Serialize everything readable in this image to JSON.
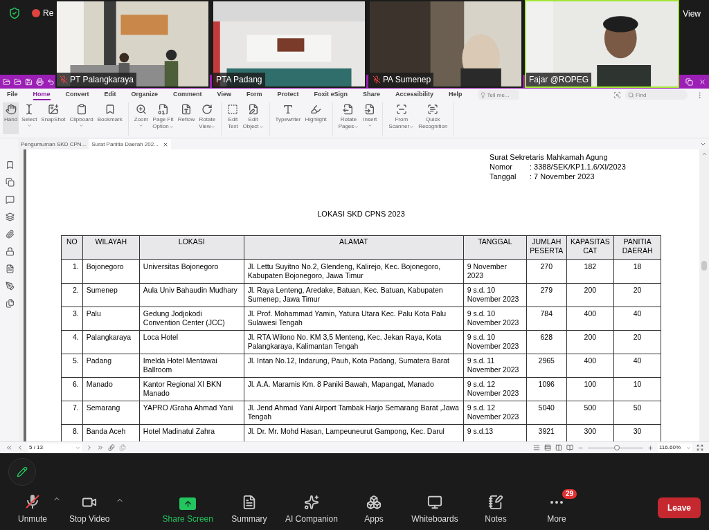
{
  "meeting": {
    "recording_label": "Re",
    "view_label": "View",
    "participants": [
      {
        "name": "PT Palangkaraya",
        "muted": true,
        "active": false
      },
      {
        "name": "PTA Padang",
        "muted": false,
        "active": false
      },
      {
        "name": "PA Sumenep",
        "muted": true,
        "active": false
      },
      {
        "name": "Fajar @ROPEG",
        "muted": false,
        "active": true
      }
    ]
  },
  "menu": [
    {
      "label": "File",
      "selected": false
    },
    {
      "label": "Home",
      "selected": true
    },
    {
      "label": "Convert",
      "selected": false
    },
    {
      "label": "Edit",
      "selected": false
    },
    {
      "label": "Organize",
      "selected": false
    },
    {
      "label": "Comment",
      "selected": false
    },
    {
      "label": "View",
      "selected": false
    },
    {
      "label": "Form",
      "selected": false
    },
    {
      "label": "Protect",
      "selected": false
    },
    {
      "label": "Foxit eSign",
      "selected": false
    },
    {
      "label": "Share",
      "selected": false
    },
    {
      "label": "Accessibility",
      "selected": false
    },
    {
      "label": "Help",
      "selected": false
    }
  ],
  "tell_me": {
    "placeholder": "Tell me..."
  },
  "find": {
    "placeholder": "Find"
  },
  "ribbon": [
    [
      {
        "lines": [
          "Hand"
        ],
        "dropdown": false,
        "selected": true
      },
      {
        "lines": [
          "Select"
        ],
        "dropdown": true,
        "selected": false
      },
      {
        "lines": [
          "SnapShot"
        ],
        "dropdown": false,
        "selected": false
      },
      {
        "lines": [
          "Clipboard"
        ],
        "dropdown": true,
        "selected": false
      },
      {
        "lines": [
          "Bookmark"
        ],
        "dropdown": false,
        "selected": false
      }
    ],
    [
      {
        "lines": [
          "Zoom"
        ],
        "dropdown": true,
        "selected": false
      },
      {
        "lines": [
          "Page Fit",
          "Option"
        ],
        "dropdown": true,
        "selected": false
      },
      {
        "lines": [
          "Reflow"
        ],
        "dropdown": false,
        "selected": false
      },
      {
        "lines": [
          "Rotate",
          "View"
        ],
        "dropdown": true,
        "selected": false
      }
    ],
    [
      {
        "lines": [
          "Edit",
          "Text"
        ],
        "dropdown": false,
        "selected": false
      },
      {
        "lines": [
          "Edit",
          "Object"
        ],
        "dropdown": true,
        "selected": false
      }
    ],
    [
      {
        "lines": [
          "Typewriter"
        ],
        "dropdown": false,
        "selected": false
      },
      {
        "lines": [
          "Highlight"
        ],
        "dropdown": false,
        "selected": false
      }
    ],
    [
      {
        "lines": [
          "Rotate",
          "Pages"
        ],
        "dropdown": true,
        "selected": false
      },
      {
        "lines": [
          "Insert"
        ],
        "dropdown": true,
        "selected": false
      }
    ],
    [
      {
        "lines": [
          "From",
          "Scanner"
        ],
        "dropdown": true,
        "selected": false
      },
      {
        "lines": [
          "Quick",
          "Recognition"
        ],
        "dropdown": false,
        "selected": false
      }
    ]
  ],
  "tabs": [
    {
      "label": "Pengumuman SKD CPN...",
      "selected": false,
      "closable": false
    },
    {
      "label": "Surat Panitia Daerah 202...",
      "selected": true,
      "closable": true
    }
  ],
  "document": {
    "letter_ref": "Surat Sekretaris Mahkamah Agung",
    "fields": [
      {
        "label": "Nomor",
        "value": ": 3388/SEK/KP1.1.6/XI/2023"
      },
      {
        "label": "Tanggal",
        "value": ": 7 November 2023"
      }
    ],
    "title": "LOKASI SKD CPNS 2023",
    "table": {
      "columns": [
        "NO",
        "WILAYAH",
        "LOKASI",
        "ALAMAT",
        "TANGGAL",
        "JUMLAH PESERTA",
        "KAPASITAS CAT",
        "PANITIA DAERAH"
      ],
      "rows": [
        [
          "1.",
          "Bojonegoro",
          "Universitas Bojonegoro",
          "Jl. Lettu Suyitno No.2, Glendeng, Kalirejo, Kec. Bojonegoro, Kabupaten Bojonegoro, Jawa Timur",
          "9 November 2023",
          "270",
          "182",
          "18"
        ],
        [
          "2.",
          "Sumenep",
          "Aula Univ Bahaudin Mudhary",
          "Jl. Raya Lenteng, Aredake, Batuan, Kec. Batuan, Kabupaten Sumenep, Jawa Timur",
          "9 s.d. 10 November 2023",
          "279",
          "200",
          "20"
        ],
        [
          "3.",
          "Palu",
          "Gedung Jodjokodi Convention Center (JCC)",
          "Jl. Prof. Mohammad Yamin, Yatura Utara Kec. Palu Kota Palu Sulawesi Tengah",
          "9 s.d. 10 November 2023",
          "784",
          "400",
          "40"
        ],
        [
          "4.",
          "Palangkaraya",
          "Loca Hotel",
          "Jl. RTA Wilono No. KM 3,5 Menteng, Kec. Jekan Raya, Kota Palangkaraya, Kalimantan Tengah",
          "9 s.d. 10 November 2023",
          "628",
          "200",
          "20"
        ],
        [
          "5.",
          "Padang",
          "Imelda Hotel Mentawai Ballroom",
          "Jl. Intan No.12, Indarung, Pauh, Kota Padang, Sumatera Barat",
          "9 s.d. 11 November 2023",
          "2965",
          "400",
          "40"
        ],
        [
          "6.",
          "Manado",
          "Kantor Regional XI BKN Manado",
          "Jl. A.A. Maramis Km. 8 Paniki Bawah, Mapangat, Manado",
          "9 s.d. 12 November 2023",
          "1096",
          "100",
          "10"
        ],
        [
          "7.",
          "Semarang",
          "YAPRO /Graha Ahmad Yani",
          "Jl. Jend Ahmad Yani Airport Tambak Harjo Semarang Barat ,Jawa Tengah",
          "9 s.d. 12 November 2023",
          "5040",
          "500",
          "50"
        ],
        [
          "8.",
          "Banda Aceh",
          "Hotel Madinatul Zahra",
          "Jl. Dr. Mr. Mohd Hasan, Lampeuneurut Gampong, Kec. Darul",
          "9 s.d.13",
          "3921",
          "300",
          "30"
        ]
      ]
    }
  },
  "status": {
    "page": "5 / 13",
    "zoom_slider": {
      "level": 0.52
    },
    "zoom": "116.60%"
  },
  "controls": {
    "tools": [
      {
        "label": "Unmute",
        "kind": "mic",
        "muted": true,
        "caret": true
      },
      {
        "label": "Stop Video",
        "kind": "video",
        "caret": true
      },
      {
        "label": "Share Screen",
        "kind": "share",
        "caret": false
      },
      {
        "label": "Summary",
        "kind": "summary",
        "caret": false
      },
      {
        "label": "AI Companion",
        "kind": "ai",
        "caret": false
      },
      {
        "label": "Apps",
        "kind": "apps",
        "caret": false
      },
      {
        "label": "Whiteboards",
        "kind": "whiteboard",
        "caret": false
      },
      {
        "label": "Notes",
        "kind": "notes",
        "caret": false
      },
      {
        "label": "More",
        "kind": "more",
        "caret": false,
        "badge": "29"
      }
    ],
    "leave": "Leave"
  }
}
